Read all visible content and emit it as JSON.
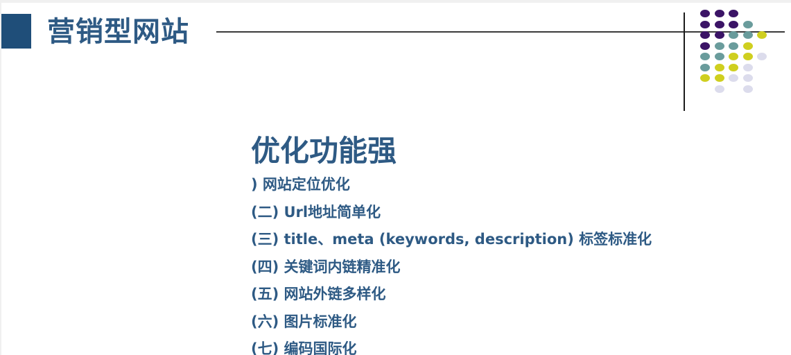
{
  "header": {
    "title": "营销型网站"
  },
  "section": {
    "heading": "优化功能强",
    "items": [
      ") 网站定位优化",
      "(二) Url地址简单化",
      "(三) title、meta (keywords, description) 标签标准化",
      " (四) 关键词内链精准化",
      "(五) 网站外链多样化",
      "(六) 图片标准化",
      "(七) 编码国际化"
    ]
  },
  "colors": {
    "title_bar": "#1f4e79",
    "text": "#2e5a84",
    "dot_purple": "#3b1466",
    "dot_teal": "#6a9c9c",
    "dot_yellow": "#cfcf1f",
    "dot_lavender": "#dcdcec"
  },
  "decoration": {
    "dot_grid": [
      [
        "purple",
        "purple",
        "purple",
        "",
        "",
        ""
      ],
      [
        "purple",
        "purple",
        "purple",
        "teal",
        "",
        ""
      ],
      [
        "purple",
        "purple",
        "teal",
        "teal",
        "yellow",
        ""
      ],
      [
        "purple",
        "teal",
        "teal",
        "yellow",
        "",
        ""
      ],
      [
        "teal",
        "teal",
        "yellow",
        "yellow",
        "lavender",
        ""
      ],
      [
        "teal",
        "yellow",
        "yellow",
        "lavender",
        "",
        ""
      ],
      [
        "yellow",
        "yellow",
        "lavender",
        "lavender",
        "",
        ""
      ],
      [
        "",
        "lavender",
        "",
        "lavender",
        "",
        ""
      ]
    ]
  }
}
